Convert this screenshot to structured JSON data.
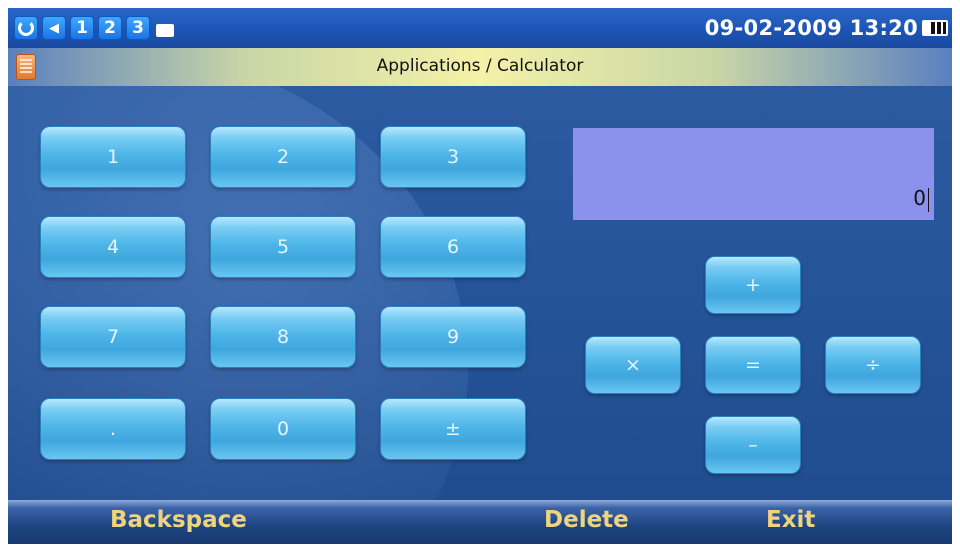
{
  "status_bar": {
    "icons": [
      "sync-icon",
      "speaker-icon",
      "line-1-icon",
      "line-2-icon",
      "line-3-icon",
      "envelope-icon"
    ],
    "line_numbers": [
      "1",
      "2",
      "3"
    ],
    "volume_glyph": "◀",
    "datetime": "09-02-2009 13:20",
    "battery_icon": "battery-icon"
  },
  "title_bar": {
    "app_icon": "calculator-icon",
    "title": "Applications / Calculator"
  },
  "keypad": [
    "1",
    "2",
    "3",
    "4",
    "5",
    "6",
    "7",
    "8",
    "9",
    ".",
    "0",
    "±"
  ],
  "display": {
    "value": "0"
  },
  "operators": {
    "plus": "+",
    "multiply": "×",
    "equals": "=",
    "divide": "÷",
    "minus": "–"
  },
  "softkeys": {
    "backspace": "Backspace",
    "delete": "Delete",
    "exit": "Exit"
  },
  "colors": {
    "display_bg": "#8b92ec",
    "softkey_text": "#efd37f",
    "key_blue": "#4fb6e9"
  }
}
